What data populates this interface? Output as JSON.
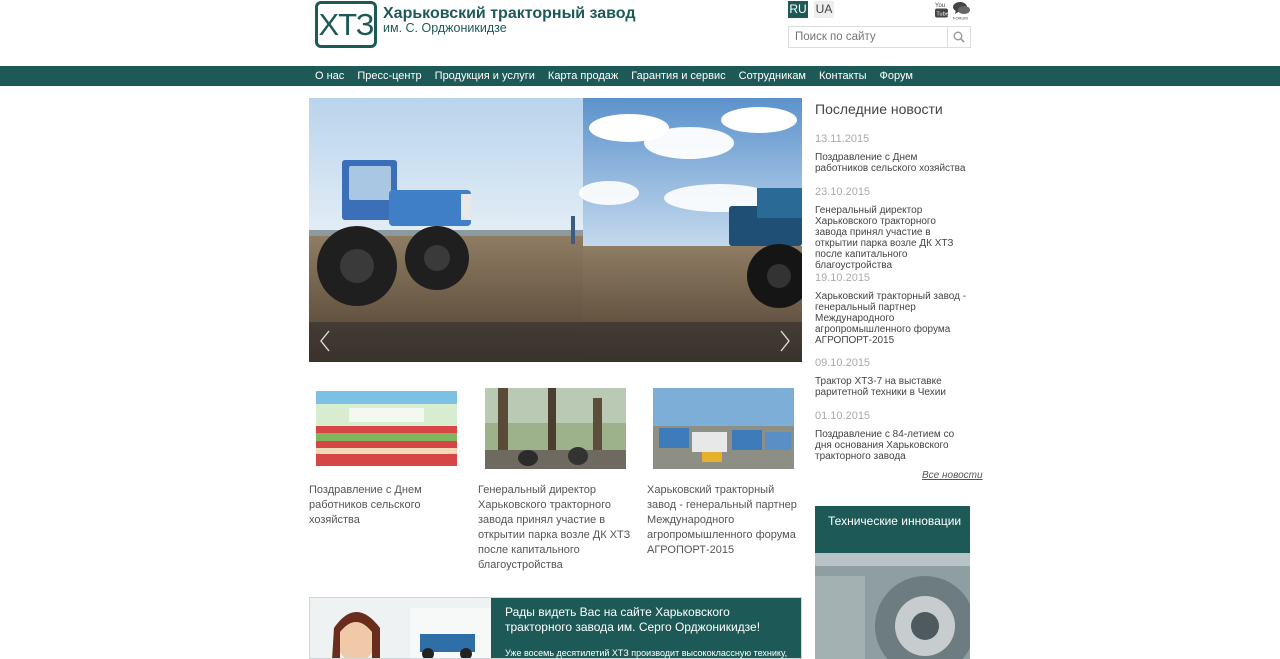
{
  "header": {
    "logo_text": "ХТЗ",
    "site_title": "Харьковский тракторный завод",
    "site_subtitle": "им. С. Орджоникидзе",
    "lang_ru": "RU",
    "lang_ua": "UA",
    "youtube_icon": "youtube-icon",
    "forum_icon": "forum-icon",
    "search_placeholder": "Поиск по сайту"
  },
  "nav": {
    "items": [
      "О нас",
      "Пресс-центр",
      "Продукция и услуги",
      "Карта продаж",
      "Гарантия и сервис",
      "Сотрудникам",
      "Контакты",
      "Форум"
    ]
  },
  "thumbs": [
    {
      "caption": "Поздравление с Днем работников сельского хозяйства"
    },
    {
      "caption": "Генеральный директор Харьковского тракторного завода принял участие в открытии парка возле ДК ХТЗ после капитального благоустройства"
    },
    {
      "caption": "Харьковский тракторный завод - генеральный партнер Международного агропромышленного форума АГРОПОРТ-2015"
    }
  ],
  "news": {
    "heading": "Последние новости",
    "items": [
      {
        "date": "13.11.2015",
        "title": "Поздравление с Днем работников сельского хозяйства"
      },
      {
        "date": "23.10.2015",
        "title": "Генеральный директор Харьковского тракторного завода принял участие в открытии парка возле ДК ХТЗ после капитального благоустройства"
      },
      {
        "date": "19.10.2015",
        "title": "Харьковский тракторный завод - генеральный партнер Международного агропромышленного форума АГРОПОРТ-2015"
      },
      {
        "date": "09.10.2015",
        "title": "Трактор ХТЗ-7 на выставке раритетной техники в Чехии"
      },
      {
        "date": "01.10.2015",
        "title": "Поздравление с 84-летием со дня основания Харьковского тракторного завода"
      }
    ],
    "all_link": "Все новости"
  },
  "innovations": {
    "heading": "Технические инновации"
  },
  "welcome": {
    "title": "Рады видеть Вас на сайте Харьковского тракторного завода им. Серго Орджоникидзе!",
    "text": "Уже восемь десятилетий ХТЗ производит высококлассную технику,"
  },
  "colors": {
    "brand": "#1d5a57"
  }
}
